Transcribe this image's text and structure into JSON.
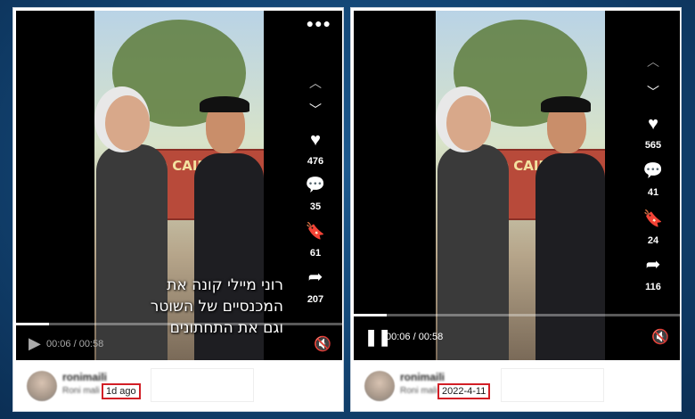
{
  "left_post": {
    "caption_lines": [
      "רוני מיילי קונה את",
      "המכנסיים של השוטר",
      "וגם את התחתונים"
    ],
    "likes": "476",
    "comments": "35",
    "saves": "61",
    "shares": "207",
    "time": "00:06 / 00:58",
    "progress": 0.1,
    "username": "ronimaili",
    "subname": "Roni mali",
    "date": "1d ago"
  },
  "right_post": {
    "likes": "565",
    "comments": "41",
    "saves": "24",
    "shares": "116",
    "time": "00:06 / 00:58",
    "progress": 0.1,
    "username": "ronimaili",
    "subname": "Roni mali",
    "date": "2022-4-11"
  },
  "scene": {
    "sign_text": "LD CAIRO"
  },
  "icons": {
    "more": "more-icon",
    "up": "chevron-up-icon",
    "down": "chevron-down-icon",
    "like": "heart-icon",
    "comment": "comment-icon",
    "save": "bookmark-icon",
    "share": "share-icon",
    "play": "play-icon",
    "pause": "pause-icon",
    "mute": "mute-icon"
  },
  "colors": {
    "background": "#144878",
    "highlight_box": "#d21f26"
  }
}
